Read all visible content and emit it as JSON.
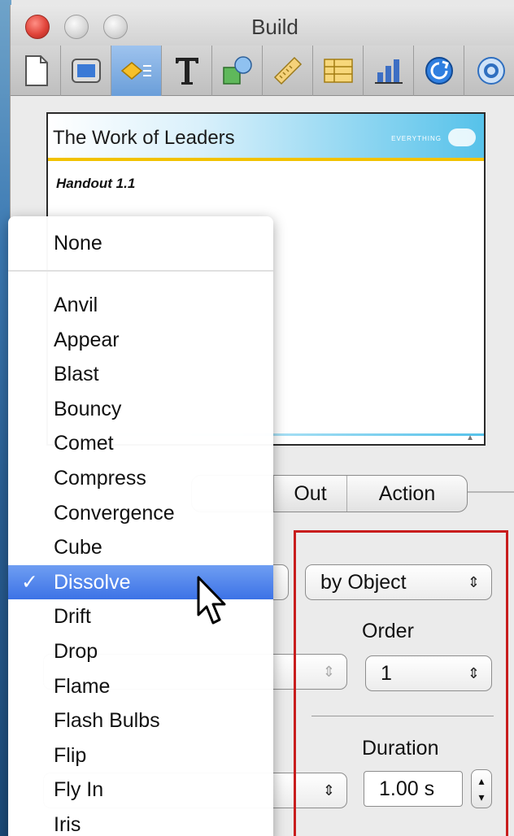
{
  "window": {
    "title": "Build"
  },
  "toolbar": {
    "items": [
      {
        "icon": "document-icon"
      },
      {
        "icon": "slide-icon"
      },
      {
        "icon": "build-diamond-icon"
      },
      {
        "icon": "text-icon"
      },
      {
        "icon": "shapes-icon"
      },
      {
        "icon": "ruler-icon"
      },
      {
        "icon": "table-icon"
      },
      {
        "icon": "chart-icon"
      },
      {
        "icon": "quicktime-icon"
      },
      {
        "icon": "links-icon"
      }
    ]
  },
  "slide": {
    "title": "The Work of Leaders",
    "logo_text": "EVERYTHING",
    "subtitle": "Handout 1.1"
  },
  "tabs": {
    "out": "Out",
    "action": "Action"
  },
  "panel": {
    "delivery_value": "by Object",
    "order_label": "Order",
    "order_value": "1",
    "duration_label": "Duration",
    "duration_value": "1.00 s"
  },
  "effect_menu": {
    "none_label": "None",
    "items": [
      "Anvil",
      "Appear",
      "Blast",
      "Bouncy",
      "Comet",
      "Compress",
      "Convergence",
      "Cube",
      "Dissolve",
      "Drift",
      "Drop",
      "Flame",
      "Flash Bulbs",
      "Flip",
      "Fly In",
      "Iris"
    ],
    "selected": "Dissolve",
    "checkmark": "✓"
  },
  "colors": {
    "highlight": "#3c72e6",
    "annotation": "#c81d1d",
    "active_tool": "#6a9ed9"
  }
}
